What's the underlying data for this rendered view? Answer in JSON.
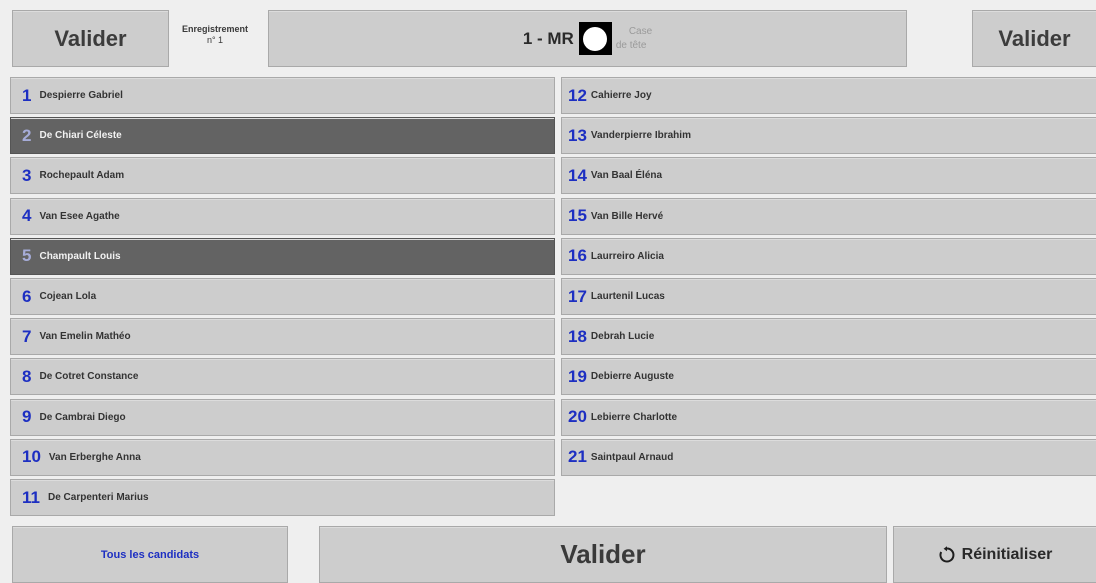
{
  "header": {
    "validate_left": "Valider",
    "registration_label": "Enregistrement",
    "registration_number": "n° 1",
    "vote_label": "1 - MR",
    "head_box_line1": "Case",
    "head_box_line2": "de tête",
    "validate_right": "Valider"
  },
  "candidates_left": [
    {
      "num": "1",
      "name": "Despierre Gabriel",
      "selected": false
    },
    {
      "num": "2",
      "name": "De Chiari Céleste",
      "selected": true
    },
    {
      "num": "3",
      "name": "Rochepault Adam",
      "selected": false
    },
    {
      "num": "4",
      "name": "Van Esee Agathe",
      "selected": false
    },
    {
      "num": "5",
      "name": "Champault Louis",
      "selected": true
    },
    {
      "num": "6",
      "name": "Cojean Lola",
      "selected": false
    },
    {
      "num": "7",
      "name": "Van Emelin Mathéo",
      "selected": false
    },
    {
      "num": "8",
      "name": "De Cotret Constance",
      "selected": false
    },
    {
      "num": "9",
      "name": "De Cambrai Diego",
      "selected": false
    },
    {
      "num": "10",
      "name": "Van Erberghe Anna",
      "selected": false
    },
    {
      "num": "11",
      "name": "De Carpenteri Marius",
      "selected": false
    }
  ],
  "candidates_right": [
    {
      "num": "12",
      "name": "Cahierre Joy",
      "selected": false
    },
    {
      "num": "13",
      "name": "Vanderpierre Ibrahim",
      "selected": false
    },
    {
      "num": "14",
      "name": "Van Baal Éléna",
      "selected": false
    },
    {
      "num": "15",
      "name": "Van Bille Hervé",
      "selected": false
    },
    {
      "num": "16",
      "name": "Laurreiro Alicia",
      "selected": false
    },
    {
      "num": "17",
      "name": "Laurtenil Lucas",
      "selected": false
    },
    {
      "num": "18",
      "name": "Debrah Lucie",
      "selected": false
    },
    {
      "num": "19",
      "name": "Debierre Auguste",
      "selected": false
    },
    {
      "num": "20",
      "name": "Lebierre Charlotte",
      "selected": false
    },
    {
      "num": "21",
      "name": "Saintpaul Arnaud",
      "selected": false
    }
  ],
  "footer": {
    "all_candidates": "Tous les candidats",
    "validate": "Valider",
    "reset": "Réinitialiser",
    "reset_icon": "reset-icon"
  },
  "colors": {
    "accent": "#1d2fc2",
    "button": "#cdcdcd",
    "selected": "#636363"
  }
}
